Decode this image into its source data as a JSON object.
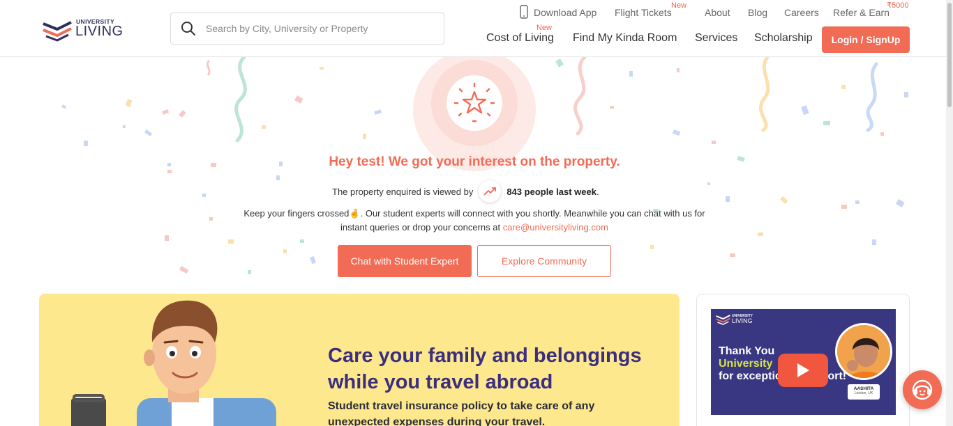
{
  "header": {
    "logo_small": "UNIVERSITY",
    "logo_big": "LIVING",
    "search_placeholder": "Search by City, University or Property",
    "top_links": {
      "download_app": "Download App",
      "flight_tickets": "Flight Tickets",
      "flight_badge": "New",
      "about": "About",
      "blog": "Blog",
      "careers": "Careers",
      "refer_earn": "Refer & Earn",
      "refer_badge": "₹5000"
    },
    "main_nav": {
      "cost_of_living": "Cost of Living",
      "cost_badge": "New",
      "find_room": "Find My Kinda Room",
      "services": "Services",
      "scholarship": "Scholarship"
    },
    "login_label": "Login / SignUp"
  },
  "confirmation": {
    "heading": "Hey test! We got your interest on the property.",
    "viewed_prefix": "The property enquired is viewed by",
    "viewed_count": "843 people last week",
    "viewed_suffix": ".",
    "message_part1": "Keep your fingers crossed",
    "message_emoji": "🤞",
    "message_part2": ". Our student experts will connect with you shortly. Meanwhile you can chat with us for instant queries or drop your concerns at ",
    "email": "care@universityliving.com",
    "chat_button": "Chat with Student Expert",
    "explore_button": "Explore Community"
  },
  "promo": {
    "title": "Care your family and belongings while you travel abroad",
    "subtitle": "Student travel insurance policy to take care of any unexpected expenses during your travel."
  },
  "video": {
    "logo_small": "UNIVERSITY",
    "logo_big": "LIVING",
    "line1": "Thank You",
    "line2": "University",
    "line3": "for exceptional support!",
    "person_name": "AASHITA",
    "person_location": "London, UK"
  },
  "colors": {
    "accent": "#f26b54",
    "brand_navy": "#2f2f5a",
    "promo_bg": "#fde88e",
    "promo_text": "#3b2e7e"
  }
}
